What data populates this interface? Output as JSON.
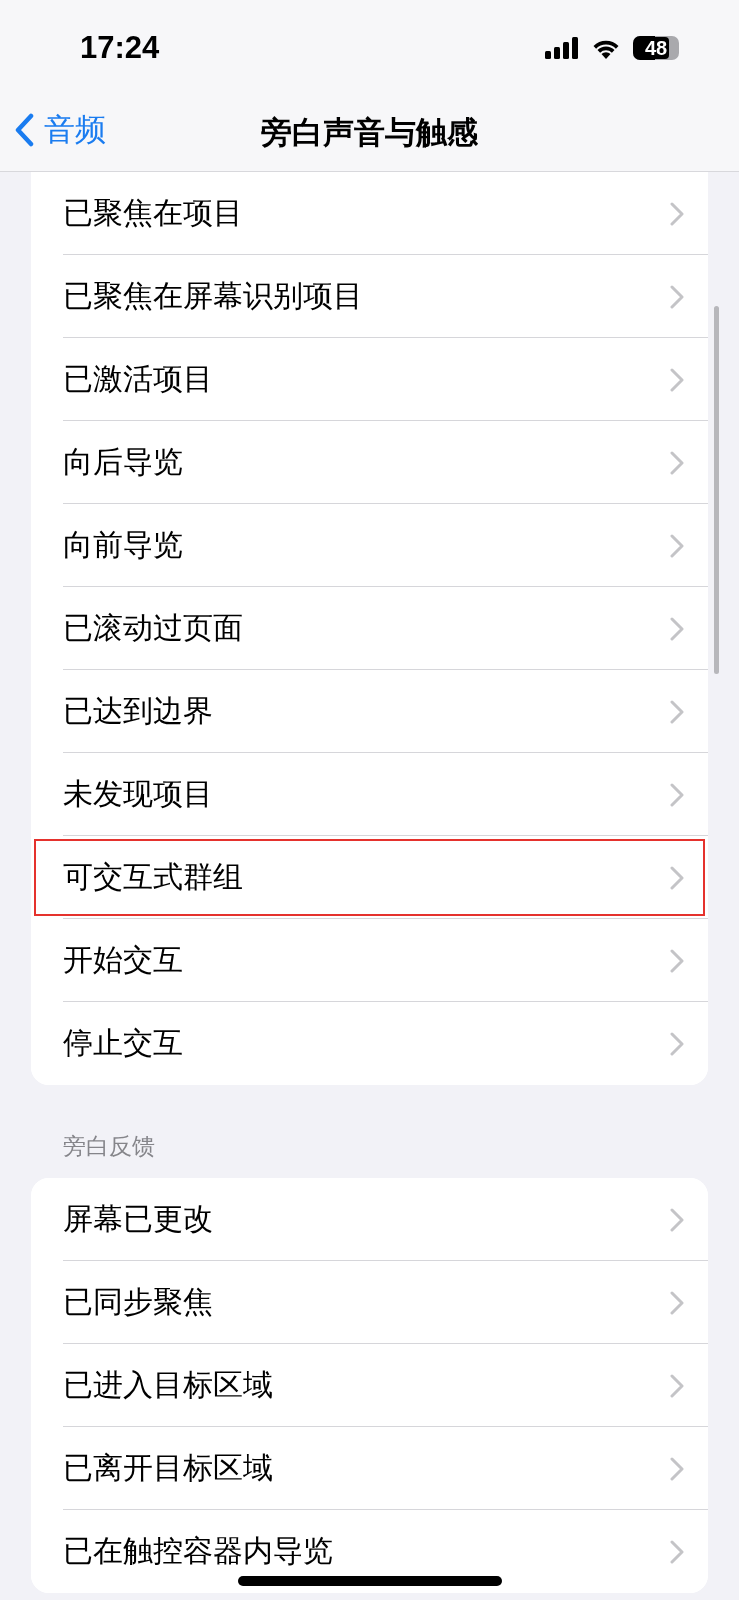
{
  "status_bar": {
    "time": "17:24",
    "battery": "48",
    "level": 0.48
  },
  "nav": {
    "back": "音频",
    "title": "旁白声音与触感"
  },
  "groups": [
    {
      "rows": [
        {
          "label": "已聚焦在项目",
          "highlighted": false
        },
        {
          "label": "已聚焦在屏幕识别项目",
          "highlighted": false
        },
        {
          "label": "已激活项目",
          "highlighted": false
        },
        {
          "label": "向后导览",
          "highlighted": false
        },
        {
          "label": "向前导览",
          "highlighted": false
        },
        {
          "label": "已滚动过页面",
          "highlighted": false
        },
        {
          "label": "已达到边界",
          "highlighted": false
        },
        {
          "label": "未发现项目",
          "highlighted": false
        },
        {
          "label": "可交互式群组",
          "highlighted": true
        },
        {
          "label": "开始交互",
          "highlighted": false
        },
        {
          "label": "停止交互",
          "highlighted": false
        }
      ]
    },
    {
      "header": "旁白反馈",
      "rows": [
        {
          "label": "屏幕已更改",
          "highlighted": false
        },
        {
          "label": "已同步聚焦",
          "highlighted": false
        },
        {
          "label": "已进入目标区域",
          "highlighted": false
        },
        {
          "label": "已离开目标区域",
          "highlighted": false
        },
        {
          "label": "已在触控容器内导览",
          "highlighted": false
        }
      ]
    }
  ]
}
